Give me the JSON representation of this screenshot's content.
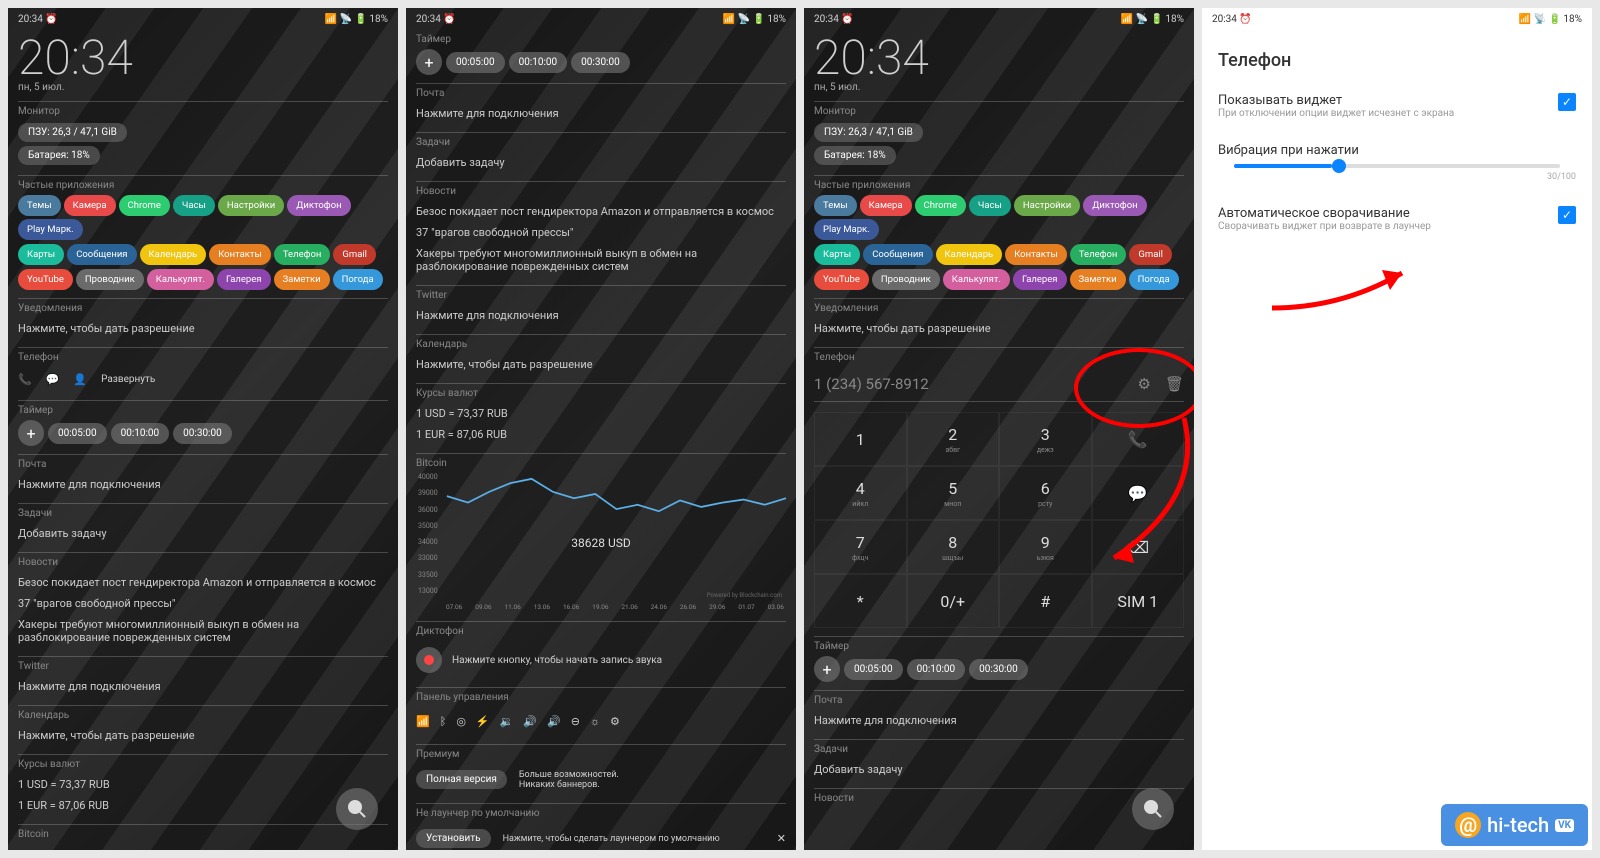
{
  "status": {
    "time": "20:34",
    "battery": "18%"
  },
  "home": {
    "time": "20:34",
    "date": "пн, 5 июл.",
    "monitor": {
      "title": "Монитор",
      "ram": "ПЗУ: 26,3 / 47,1 GiB",
      "bat": "Батарея: 18%"
    },
    "apps": {
      "title": "Частые приложения",
      "row1": [
        {
          "l": "Темы",
          "c": "#4a7a9e"
        },
        {
          "l": "Камера",
          "c": "#e84a4a"
        },
        {
          "l": "Chrome",
          "c": "#2ecc71"
        },
        {
          "l": "Часы",
          "c": "#16a085"
        },
        {
          "l": "Настройки",
          "c": "#6aa84a"
        },
        {
          "l": "Диктофон",
          "c": "#9b59b6"
        },
        {
          "l": "Play Марк.",
          "c": "#3b5998"
        }
      ],
      "row2": [
        {
          "l": "Карты",
          "c": "#1abc9c"
        },
        {
          "l": "Сообщения",
          "c": "#2a6496"
        },
        {
          "l": "Календарь",
          "c": "#f1c40f"
        },
        {
          "l": "Контакты",
          "c": "#e67e22"
        },
        {
          "l": "Телефон",
          "c": "#27ae60"
        },
        {
          "l": "Gmail",
          "c": "#c0392b"
        }
      ],
      "row3": [
        {
          "l": "YouTube",
          "c": "#e74c3c"
        },
        {
          "l": "Проводник",
          "c": "#6a6a6a"
        },
        {
          "l": "Калькулят.",
          "c": "#d35f9e"
        },
        {
          "l": "Галерея",
          "c": "#8e44ad"
        },
        {
          "l": "Заметки",
          "c": "#e67e22"
        },
        {
          "l": "Погода",
          "c": "#3498db"
        }
      ]
    },
    "notif": {
      "title": "Уведомления",
      "text": "Нажмите, чтобы дать разрешение"
    },
    "phone": {
      "title": "Телефон",
      "expand": "Развернуть"
    },
    "timer": {
      "title": "Таймер",
      "presets": [
        "00:05:00",
        "00:10:00",
        "00:30:00"
      ]
    },
    "mail": {
      "title": "Почта",
      "text": "Нажмите для подключения"
    },
    "tasks": {
      "title": "Задачи",
      "text": "Добавить задачу"
    },
    "news": {
      "title": "Новости",
      "items": [
        "Безос покидает пост гендиректора Amazon и отправляется в космос",
        "37 \"врагов свободной прессы\"",
        "Хакеры требуют многомиллионный выкуп в обмен на разблокирование поврежденных систем"
      ]
    },
    "twitter": {
      "title": "Twitter",
      "text": "Нажмите для подключения"
    },
    "calendar": {
      "title": "Календарь",
      "text": "Нажмите, чтобы дать разрешение"
    },
    "fx": {
      "title": "Курсы валют",
      "usd": "1 USD = 73,37 RUB",
      "eur": "1 EUR = 87,06 RUB"
    },
    "bitcoin": {
      "title": "Bitcoin"
    }
  },
  "screen2": {
    "timer_title": "Таймер",
    "bitcoin": {
      "title": "Bitcoin",
      "price": "38628 USD",
      "powered": "Powered by Blockchain.com"
    },
    "rec": {
      "title": "Диктофон",
      "text": "Нажмите кнопку, чтобы начать запись звука"
    },
    "ctrl": {
      "title": "Панель управления"
    },
    "premium": {
      "title": "Премиум",
      "full": "Полная версия",
      "more": "Больше возможностей.\nНикаких баннеров."
    },
    "launcher": {
      "title": "Не лаунчер по умолчанию",
      "install": "Установить",
      "text": "Нажмите, чтобы сделать лаунчером по умолчанию"
    }
  },
  "screen3": {
    "number": "1 (234) 567-8912",
    "keys": [
      {
        "n": "1",
        "s": ""
      },
      {
        "n": "2",
        "s": "абвг"
      },
      {
        "n": "3",
        "s": "дежз"
      },
      {
        "n": "call",
        "s": ""
      },
      {
        "n": "4",
        "s": "ийкл"
      },
      {
        "n": "5",
        "s": "мноп"
      },
      {
        "n": "6",
        "s": "рсту"
      },
      {
        "n": "sms",
        "s": ""
      },
      {
        "n": "7",
        "s": "фхцч"
      },
      {
        "n": "8",
        "s": "шщъы"
      },
      {
        "n": "9",
        "s": "ьэюя"
      },
      {
        "n": "del",
        "s": ""
      },
      {
        "n": "*",
        "s": ""
      },
      {
        "n": "0/+",
        "s": ""
      },
      {
        "n": "#",
        "s": ""
      },
      {
        "n": "SIM 1",
        "s": ""
      }
    ]
  },
  "screen4": {
    "title": "Телефон",
    "opt1": {
      "t": "Показывать виджет",
      "s": "При отключении опции виджет исчезнет с экрана"
    },
    "opt2": {
      "t": "Вибрация при нажатии",
      "v": "30/100"
    },
    "opt3": {
      "t": "Автоматическое сворачивание",
      "s": "Сворачивать виджет при возврате в лаунчер"
    }
  },
  "chart_data": {
    "type": "line",
    "title": "Bitcoin",
    "x": [
      "07.06",
      "09.06",
      "11.06",
      "13.06",
      "16.06",
      "19.06",
      "21.06",
      "24.06",
      "26.06",
      "29.06",
      "01.07",
      "03.06"
    ],
    "ylim": [
      13000,
      40000
    ],
    "yticks": [
      40000,
      39000,
      36000,
      35000,
      34000,
      33000,
      33500,
      13000
    ],
    "values": [
      36000,
      34500,
      37000,
      39000,
      40000,
      37000,
      35500,
      36500,
      33000,
      34000,
      32500,
      35000,
      33500,
      34500,
      35200,
      34000,
      35500
    ],
    "annotation": "38628 USD"
  },
  "watermark": "hi-tech"
}
